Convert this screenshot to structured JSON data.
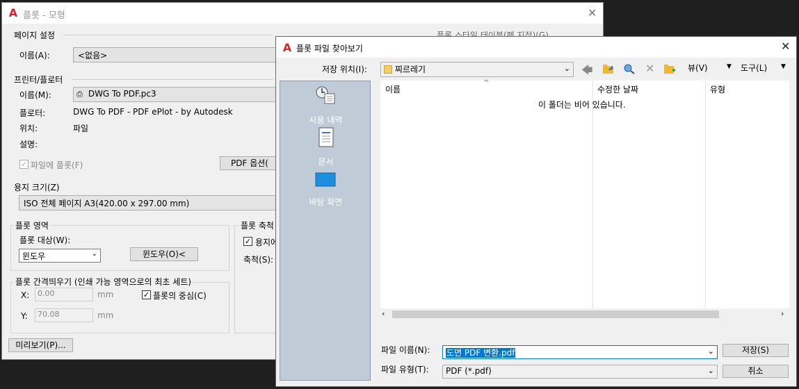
{
  "back_dialog": {
    "title": "플롯 - 모형",
    "page_setup": {
      "group": "페이지 설정",
      "name_label": "이름(A):",
      "name_value": "<없음>"
    },
    "plot_style_table_partial": "플롯 스타일 테이블(펜 지정)(G)",
    "printer": {
      "group": "프린터/플로터",
      "name_label": "이름(M):",
      "name_value": "DWG To PDF.pc3",
      "plotter_label": "플로터:",
      "plotter_value": "DWG To PDF - PDF ePlot - by Autodesk",
      "where_label": "위치:",
      "where_value": "파일",
      "desc_label": "설명:",
      "plot_to_file": "파일에 플롯(F)",
      "pdf_options": "PDF 옵션("
    },
    "paper_size": {
      "group": "용지 크기(Z)",
      "value": "ISO 전체 페이지 A3(420.00 x 297.00 mm)"
    },
    "plot_area": {
      "group": "플롯 영역",
      "what_label": "플롯 대상(W):",
      "what_value": "윈도우",
      "window_button": "윈도우(O)<"
    },
    "plot_scale": {
      "group": "플롯 축척",
      "fit_label": "용지에",
      "scale_label": "축척(S):"
    },
    "plot_offset": {
      "group": "플롯 간격띄우기 (인쇄 가능 영역으로의 최초 세트)",
      "x_label": "X:",
      "x_value": "0.00",
      "y_label": "Y:",
      "y_value": "70.08",
      "unit": "mm",
      "center_label": "플롯의 중심(C)"
    },
    "preview_button": "미리보기(P)..."
  },
  "front_dialog": {
    "title": "플롯 파일 찾아보기",
    "save_in_label": "저장 위치(I):",
    "save_in_value": "찌르레기",
    "toolbar": {
      "views_label": "뷰(V)",
      "tools_label": "도구(L)"
    },
    "places": [
      {
        "label": "사용 내역",
        "icon": "history-icon"
      },
      {
        "label": "문서",
        "icon": "documents-icon"
      },
      {
        "label": "바탕 화면",
        "icon": "desktop-icon"
      }
    ],
    "columns": [
      "이름",
      "수정한 날짜",
      "유형"
    ],
    "empty_message": "이 폴더는 비어 있습니다.",
    "file_name_label": "파일 이름(N):",
    "file_name_value": "도면 PDF 변환.pdf",
    "file_type_label": "파일 유형(T):",
    "file_type_value": "PDF (*.pdf)",
    "save_button": "저장(S)",
    "cancel_button": "취소"
  },
  "colors": {
    "autocad_red": "#d6242a",
    "selection_blue": "#0078d7",
    "places_bg": "#bfccd8"
  }
}
